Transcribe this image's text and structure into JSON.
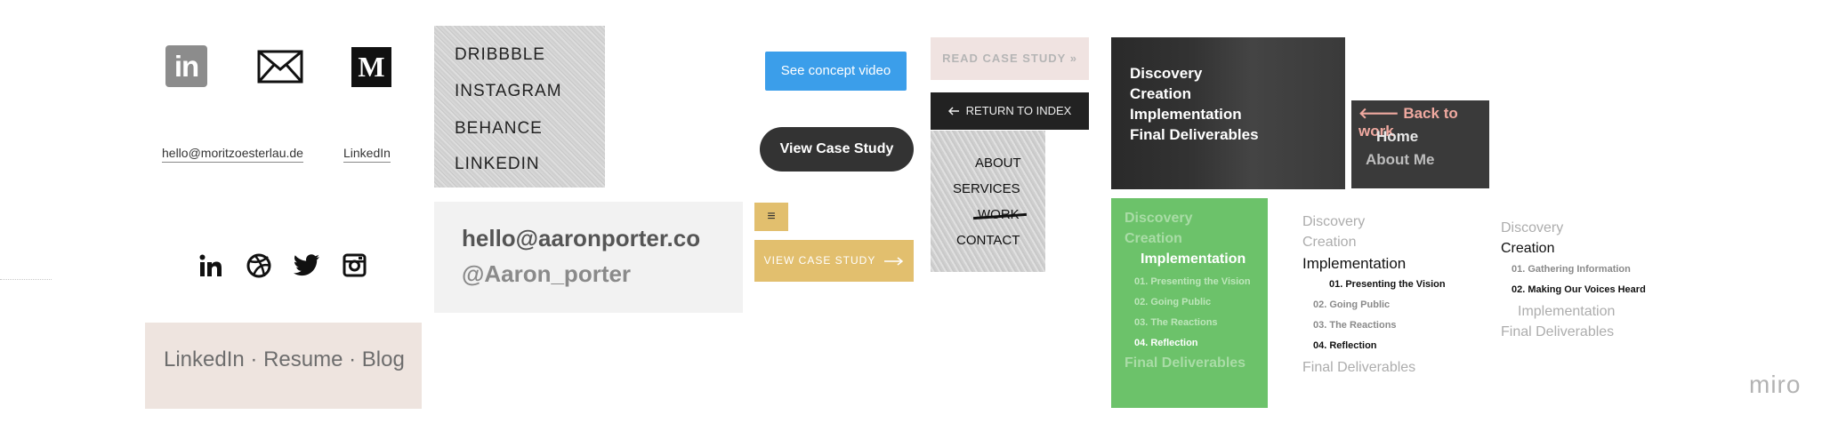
{
  "icons": [
    "linkedin-icon",
    "mail-icon",
    "medium-icon",
    "linkedin-icon",
    "dribbble-icon",
    "twitter-icon",
    "instagram-icon",
    "arrow-right-icon",
    "arrow-left-icon",
    "hamburger-icon"
  ],
  "links": {
    "email": "hello@moritzoesterlau.de",
    "linkedin": "LinkedIn"
  },
  "medium_letter": "M",
  "linkedin_letters": "in",
  "beige_links": "LinkedIn · Resume · Blog",
  "granite_menu": [
    "DRIBBBLE",
    "INSTAGRAM",
    "BEHANCE",
    "LINKEDIN"
  ],
  "hello_box": {
    "email": "hello@aaronporter.co",
    "handle": "@Aaron_porter"
  },
  "buttons": {
    "concept": "See concept video",
    "view_case_study": "View Case Study",
    "hamburger": "≡",
    "view_case_study_caps": "VIEW CASE STUDY",
    "read_case_study": "READ CASE STUDY »",
    "return_to_index": "RETURN TO INDEX"
  },
  "granite_menu2": [
    "ABOUT",
    "SERVICES",
    "WORK",
    "CONTACT"
  ],
  "photo_nav": [
    "Discovery",
    "Creation",
    "Implementation",
    "Final Deliverables"
  ],
  "back_nav": {
    "back": "Back to work",
    "home": "Home",
    "about": "About Me"
  },
  "green_nav": {
    "discovery": "Discovery",
    "creation": "Creation",
    "implementation": "Implementation",
    "sub": [
      "01. Presenting the Vision",
      "02. Going Public",
      "03. The Reactions",
      "04. Reflection"
    ],
    "final": "Final Deliverables"
  },
  "nav_col1": {
    "discovery": "Discovery",
    "creation": "Creation",
    "implementation": "Implementation",
    "sub": [
      "01. Presenting the Vision",
      "02. Going Public",
      "03. The Reactions",
      "04. Reflection"
    ],
    "final": "Final Deliverables"
  },
  "nav_col2": {
    "discovery": "Discovery",
    "creation": "Creation",
    "sub": [
      "01. Gathering Information",
      "02. Making Our Voices Heard"
    ],
    "implementation": "Implementation",
    "final": "Final Deliverables"
  },
  "brand": "miro",
  "colors": {
    "blue": "#3b9eea",
    "gold": "#e2bf6e",
    "green": "#6cc26a",
    "pink": "#f0a9a0",
    "beige": "#eee4df"
  }
}
